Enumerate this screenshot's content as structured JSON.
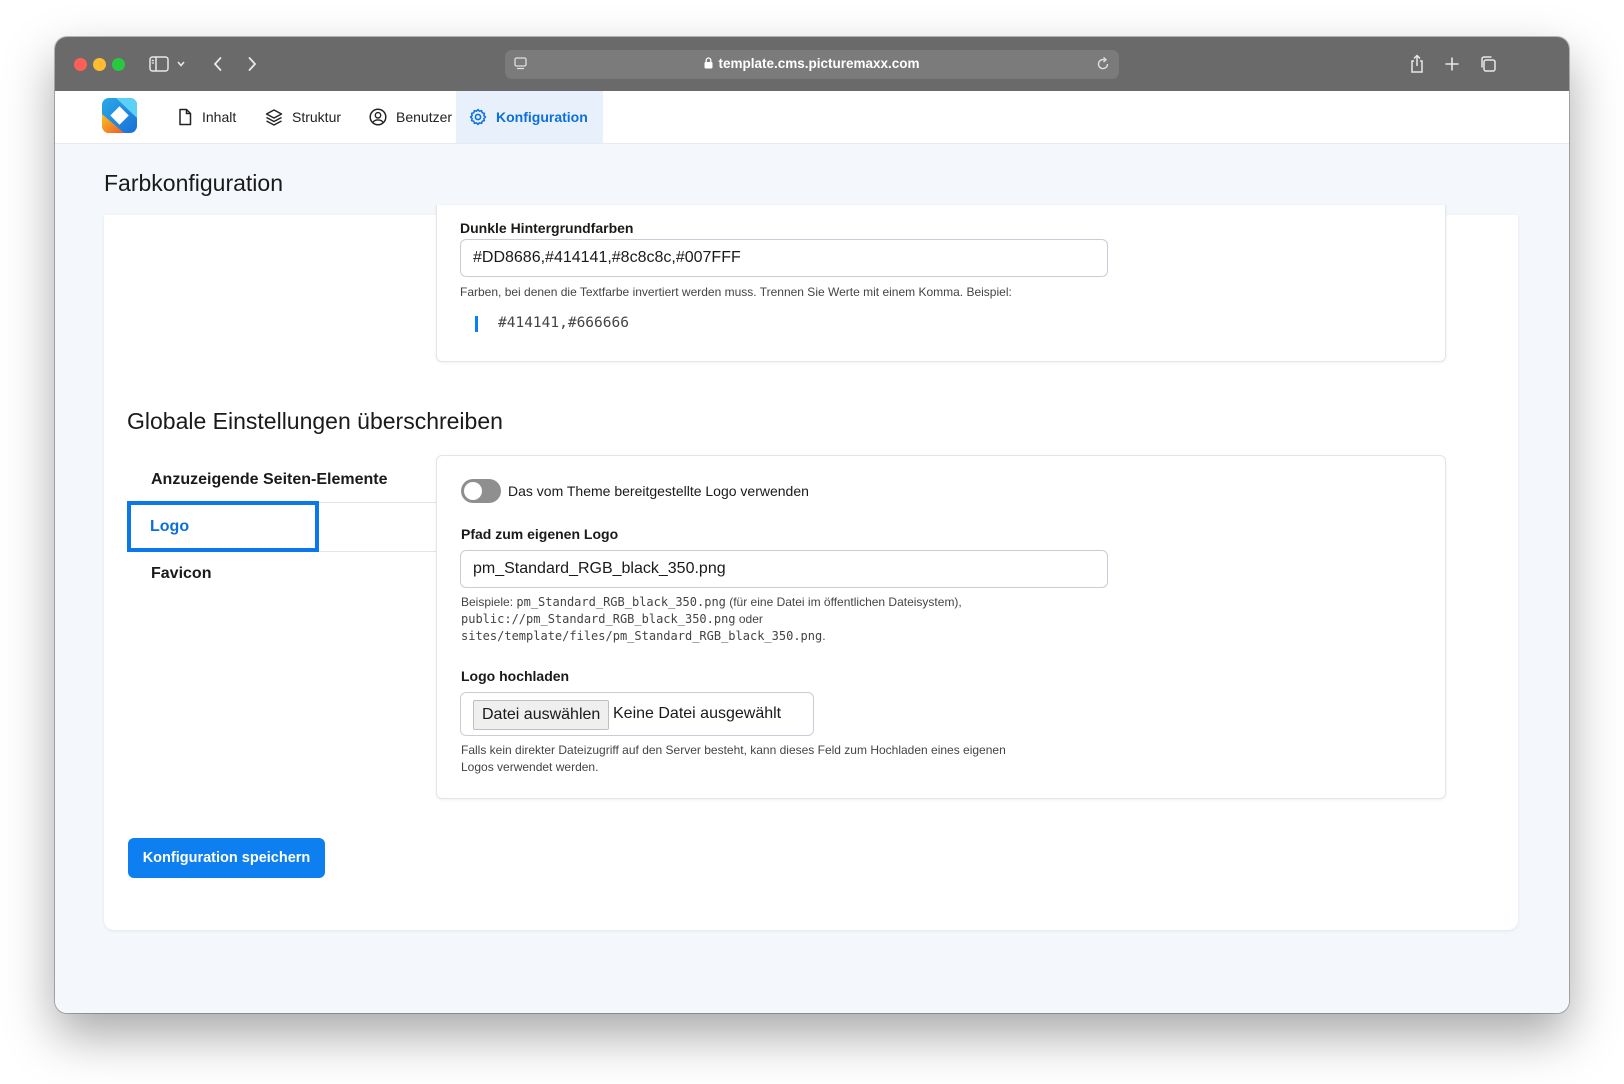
{
  "browser": {
    "url": "template.cms.picturemaxx.com"
  },
  "nav": {
    "items": [
      {
        "label": "Inhalt",
        "icon": "document-icon"
      },
      {
        "label": "Struktur",
        "icon": "layers-icon"
      },
      {
        "label": "Benutzer",
        "icon": "user-circle-icon"
      },
      {
        "label": "Konfiguration",
        "icon": "gear-icon",
        "active": true
      }
    ]
  },
  "page": {
    "title": "Farbkonfiguration"
  },
  "dark_colors": {
    "label": "Dunkle Hintergrundfarben",
    "value": "#DD8686,#414141,#8c8c8c,#007FFF",
    "help": "Farben, bei denen die Textfarbe invertiert werden muss. Trennen Sie Werte mit einem Komma. Beispiel:",
    "example": "#414141,#666666"
  },
  "global": {
    "title": "Globale Einstellungen überschreiben",
    "tabs": [
      {
        "label": "Anzuzeigende Seiten-Elemente"
      },
      {
        "label": "Logo",
        "active": true
      },
      {
        "label": "Favicon"
      }
    ]
  },
  "logo": {
    "toggle_label": "Das vom Theme bereitgestellte Logo verwenden",
    "toggle_on": false,
    "path_label": "Pfad zum eigenen Logo",
    "path_value": "pm_Standard_RGB_black_350.png",
    "help_prefix": "Beispiele: ",
    "help_example1": "pm_Standard_RGB_black_350.png",
    "help_mid1": " (für eine Datei im öffentlichen Dateisystem),",
    "help_example2": "public://pm_Standard_RGB_black_350.png",
    "help_mid2": " oder",
    "help_example3": "sites/template/files/pm_Standard_RGB_black_350.png",
    "help_end": ".",
    "upload_label": "Logo hochladen",
    "upload_button": "Datei auswählen",
    "upload_status": "Keine Datei ausgewählt",
    "upload_help_line1": "Falls kein direkter Dateizugriff auf den Server besteht, kann dieses Feld zum Hochladen eines eigenen",
    "upload_help_line2": "Logos verwendet werden."
  },
  "actions": {
    "save_label": "Konfiguration speichern"
  },
  "colors": {
    "accent": "#0d7ff0",
    "active_tab_border": "#0b78ea"
  }
}
